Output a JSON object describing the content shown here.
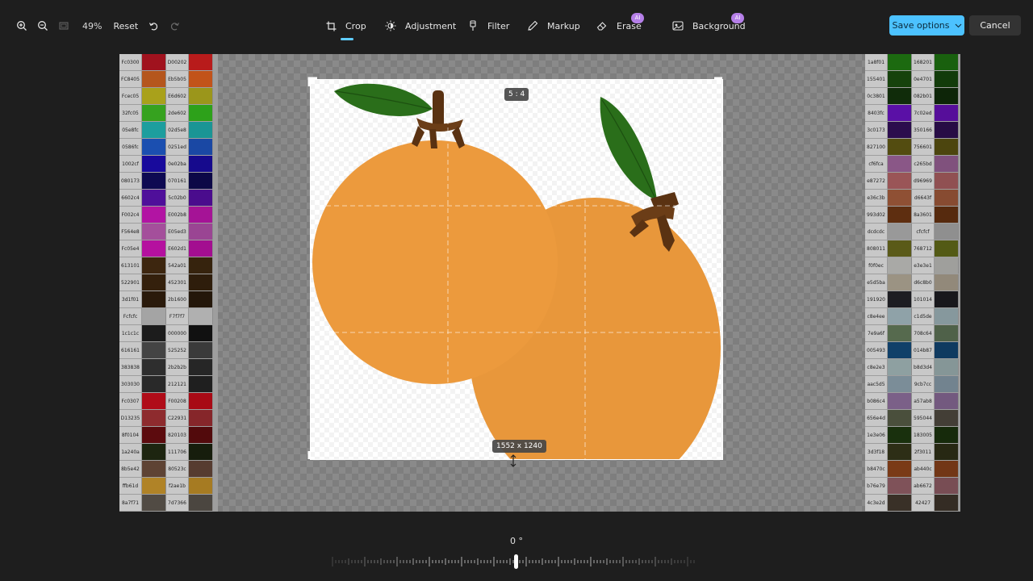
{
  "toolbar": {
    "zoom_in_icon": "zoom-in-icon",
    "zoom_out_icon": "zoom-out-icon",
    "fit_icon": "fit-to-window-icon",
    "zoom_level": "49%",
    "reset_label": "Reset",
    "undo_icon": "undo-icon",
    "redo_icon": "redo-icon",
    "tools": [
      {
        "label": "Crop",
        "icon": "crop-icon",
        "active": true
      },
      {
        "label": "Adjustment",
        "icon": "brightness-icon"
      },
      {
        "label": "Filter",
        "icon": "filter-icon"
      },
      {
        "label": "Markup",
        "icon": "pen-icon"
      },
      {
        "label": "Erase",
        "icon": "eraser-icon",
        "badge": "AI"
      },
      {
        "label": "Background",
        "icon": "background-icon",
        "badge": "AI"
      }
    ],
    "save_label": "Save options",
    "cancel_label": "Cancel"
  },
  "crop": {
    "aspect_ratio": "5 : 4",
    "dimensions": "1552 x 1240"
  },
  "rotation": {
    "angle": "0 °"
  },
  "palette_left": [
    {
      "a": "Fc0300",
      "c1": "#a0121e",
      "b": "D00202",
      "c2": "#b81b1b"
    },
    {
      "a": "FC8405",
      "c1": "#b5561d",
      "b": "Eb5b05",
      "c2": "#c2531a"
    },
    {
      "a": "Fcec05",
      "c1": "#a9a11b",
      "b": "E6d602",
      "c2": "#9b961b"
    },
    {
      "a": "32fc05",
      "c1": "#36a21f",
      "b": "2de602",
      "c2": "#2da11a"
    },
    {
      "a": "05e8fc",
      "c1": "#1d9e9e",
      "b": "02d5e8",
      "c2": "#1a9595"
    },
    {
      "a": "0586fc",
      "c1": "#1b4fb0",
      "b": "0251ed",
      "c2": "#1a48a4"
    },
    {
      "a": "1002cf",
      "c1": "#180a9c",
      "b": "0e02ba",
      "c2": "#160a8d"
    },
    {
      "a": "080173",
      "c1": "#0e0a52",
      "b": "070161",
      "c2": "#0c0847"
    },
    {
      "a": "6602c4",
      "c1": "#4f0f9a",
      "b": "5c02b0",
      "c2": "#4a0c8d"
    },
    {
      "a": "F002c4",
      "c1": "#b214a3",
      "b": "E002b8",
      "c2": "#a51396"
    },
    {
      "a": "F564e8",
      "c1": "#a44f9b",
      "b": "E05ed3",
      "c2": "#9a4593"
    },
    {
      "a": "Fc05e4",
      "c1": "#b5109f",
      "b": "E602d1",
      "c2": "#a30e90"
    },
    {
      "a": "613101",
      "c1": "#3d260f",
      "b": "542a01",
      "c2": "#36230d"
    },
    {
      "a": "522901",
      "c1": "#34200c",
      "b": "452301",
      "c2": "#2e1d0b"
    },
    {
      "a": "3d1f01",
      "c1": "#2a1a0b",
      "b": "2b1600",
      "c2": "#24170a"
    },
    {
      "a": "Fcfcfc",
      "c1": "#a4a4a4",
      "b": "F7f7f7",
      "c2": "#b0b0b0"
    },
    {
      "a": "1c1c1c",
      "c1": "#1c1c1c",
      "b": "000000",
      "c2": "#111111"
    },
    {
      "a": "616161",
      "c1": "#444444",
      "b": "525252",
      "c2": "#3a3a3a"
    },
    {
      "a": "383838",
      "c1": "#2e2e2e",
      "b": "2b2b2b",
      "c2": "#262626"
    },
    {
      "a": "303030",
      "c1": "#292929",
      "b": "212121",
      "c2": "#1f1f1f"
    },
    {
      "a": "Fc0307",
      "c1": "#b00c18",
      "b": "F00208",
      "c2": "#a80a15"
    },
    {
      "a": "D13235",
      "c1": "#8e2b2e",
      "b": "C22931",
      "c2": "#86262a"
    },
    {
      "a": "8f0104",
      "c1": "#5c0b0e",
      "b": "820103",
      "c2": "#520a0c"
    },
    {
      "a": "1a240a",
      "c1": "#1d2510",
      "b": "111706",
      "c2": "#161d0c"
    },
    {
      "a": "8b5e42",
      "c1": "#5e4334",
      "b": "80523c",
      "c2": "#563c30"
    },
    {
      "a": "ffb61d",
      "c1": "#b08327",
      "b": "f2ae1b",
      "c2": "#a67b22"
    },
    {
      "a": "8a7f71",
      "c1": "#514b44",
      "b": "7d7366",
      "c2": "#4b4640"
    }
  ],
  "palette_right": [
    {
      "a": "1a8f01",
      "c1": "#1c6a10",
      "b": "168201",
      "c2": "#19600e"
    },
    {
      "a": "155401",
      "c1": "#16420c",
      "b": "0e4701",
      "c2": "#123b0a"
    },
    {
      "a": "0c3801",
      "c1": "#102c0a",
      "b": "082b01",
      "c2": "#0d2508"
    },
    {
      "a": "8403fc",
      "c1": "#5a10a6",
      "b": "7c02ed",
      "c2": "#560e9a"
    },
    {
      "a": "3c0173",
      "c1": "#2b0d4d",
      "b": "350166",
      "c2": "#270c45"
    },
    {
      "a": "827100",
      "c1": "#534c10",
      "b": "756601",
      "c2": "#4c450e"
    },
    {
      "a": "cf6fca",
      "c1": "#8a5787",
      "b": "c265bd",
      "c2": "#80517d"
    },
    {
      "a": "e87272",
      "c1": "#9a5557",
      "b": "d96969",
      "c2": "#905052"
    },
    {
      "a": "e36c3b",
      "c1": "#8f5034",
      "b": "d6643f",
      "c2": "#874b31"
    },
    {
      "a": "993d02",
      "c1": "#5e2e10",
      "b": "8a3601",
      "c2": "#562a0e"
    },
    {
      "a": "dcdcdc",
      "c1": "#999999",
      "b": "cfcfcf",
      "c2": "#8f8f8f"
    },
    {
      "a": "808011",
      "c1": "#5a5a18",
      "b": "768712",
      "c2": "#535a15"
    },
    {
      "a": "f0f0ec",
      "c1": "#a9a9a6",
      "b": "e3e3e1",
      "c2": "#9f9f9c"
    },
    {
      "a": "e5d5ba",
      "c1": "#9b9383",
      "b": "d6c8b0",
      "c2": "#92897a"
    },
    {
      "a": "191920",
      "c1": "#1d1d22",
      "b": "101014",
      "c2": "#18181c"
    },
    {
      "a": "c8e4ee",
      "c1": "#8fa2a8",
      "b": "c1d5de",
      "c2": "#86989d"
    },
    {
      "a": "7e9a6f",
      "c1": "#566a4e",
      "b": "708c64",
      "c2": "#4f6149"
    },
    {
      "a": "005493",
      "c1": "#104069",
      "b": "014b87",
      "c2": "#0f3a60"
    },
    {
      "a": "c8e2e3",
      "c1": "#8ea0a1",
      "b": "b8d3d4",
      "c2": "#859697"
    },
    {
      "a": "aac5d5",
      "c1": "#7b8d98",
      "b": "9cb7cc",
      "c2": "#72838f"
    },
    {
      "a": "b086c4",
      "c1": "#7b6088",
      "b": "a57ab8",
      "c2": "#73597f"
    },
    {
      "a": "656e4d",
      "c1": "#4a4f3c",
      "b": "595044",
      "c2": "#433e36"
    },
    {
      "a": "1e3e06",
      "c1": "#19300d",
      "b": "183005",
      "c2": "#162a0b"
    },
    {
      "a": "3d3f18",
      "c1": "#2d2e16",
      "b": "2f3011",
      "c2": "#272813"
    },
    {
      "a": "b8470c",
      "c1": "#7a3a17",
      "b": "ab440c",
      "c2": "#723616"
    },
    {
      "a": "b76e79",
      "c1": "#7f5259",
      "b": "ab6672",
      "c2": "#784d54"
    },
    {
      "a": "4c3e2d",
      "c1": "#393027",
      "b": "42427",
      "c2": "#342c24"
    }
  ]
}
